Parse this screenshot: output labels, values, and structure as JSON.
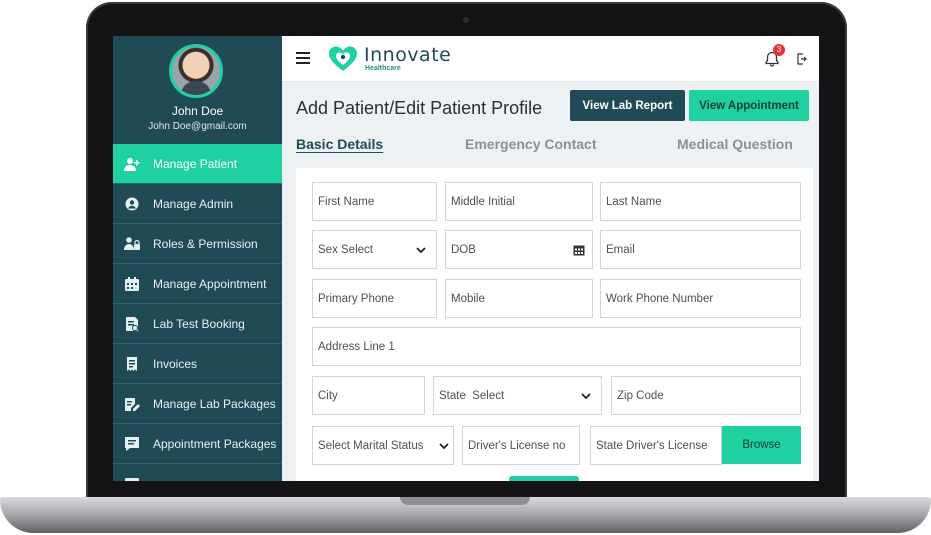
{
  "user": {
    "name": "John Doe",
    "email": "John Doe@gmail.com"
  },
  "sidebar": {
    "items": [
      {
        "label": "Manage Patient",
        "icon": "add-user-icon",
        "active": true
      },
      {
        "label": "Manage Admin",
        "icon": "gear-user-icon",
        "active": false
      },
      {
        "label": "Roles & Permission",
        "icon": "users-lock-icon",
        "active": false
      },
      {
        "label": "Manage Appointment",
        "icon": "calendar-icon",
        "active": false
      },
      {
        "label": "Lab Test Booking",
        "icon": "lab-booking-icon",
        "active": false
      },
      {
        "label": "Invoices",
        "icon": "invoice-icon",
        "active": false
      },
      {
        "label": "Manage Lab Packages",
        "icon": "package-edit-icon",
        "active": false
      },
      {
        "label": "Appointment Packages",
        "icon": "appointment-package-icon",
        "active": false
      }
    ]
  },
  "header": {
    "brand": "Innovate",
    "brand_sub": "Healthcare",
    "notification_count": "3"
  },
  "page": {
    "title": "Add Patient/Edit Patient Profile",
    "view_lab_report": "View Lab Report",
    "view_appointment": "View Appointment"
  },
  "tabs": [
    "Basic Details",
    "Emergency Contact",
    "Medical Question"
  ],
  "form": {
    "first_name": "First Name",
    "middle_initial": "Middle Initial",
    "last_name": "Last Name",
    "sex_select": "Sex Select",
    "dob": "DOB",
    "email": "Email",
    "primary_phone": "Primary Phone",
    "mobile": "Mobile",
    "work_phone": "Work Phone Number",
    "address_line_1": "Address Line 1",
    "city": "City",
    "state_select": "State  Select",
    "zip_code": "Zip Code",
    "marital_status": "Select Marital Status",
    "drivers_license": "Driver's License no",
    "state_drivers_license": "State Driver's License",
    "browse": "Browse"
  },
  "colors": {
    "sidebar": "#1f4a56",
    "accent": "#1fd1a0",
    "badge": "#e0353b"
  }
}
